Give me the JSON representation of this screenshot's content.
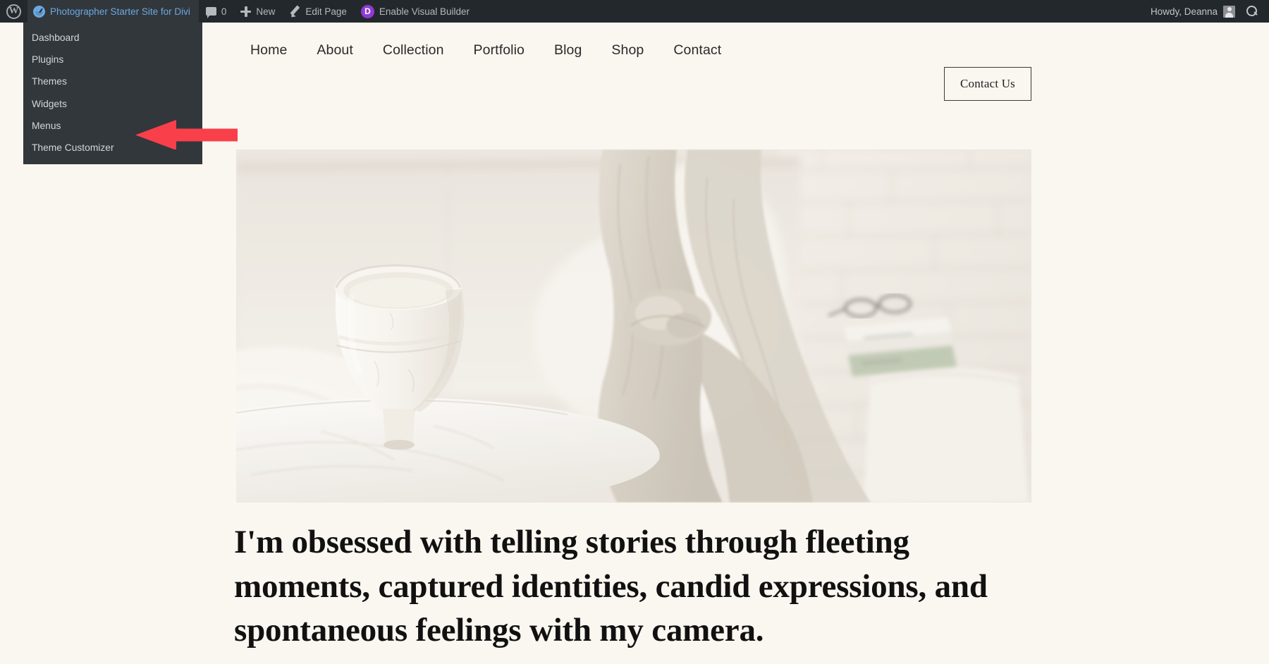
{
  "adminbar": {
    "wp_logo_glyph": "W",
    "site_name": "Photographer Starter Site for Divi",
    "comments_count": "0",
    "new_label": "New",
    "edit_page_label": "Edit Page",
    "divi_glyph": "D",
    "visual_builder_label": "Enable Visual Builder",
    "howdy": "Howdy, Deanna",
    "icons": {
      "wp_logo": "wordpress-logo-icon",
      "dashboard": "divi-dashboard-icon",
      "comments": "comment-bubble-icon",
      "new": "plus-icon",
      "edit": "pencil-icon",
      "divi": "divi-logo-icon",
      "avatar": "user-avatar-icon",
      "search": "search-icon"
    },
    "colors": {
      "bar_bg": "#23282d",
      "site_item_bg": "#32373c",
      "site_link": "#6aa9e0",
      "divi_purple": "#8f3bd4",
      "text": "#b4b9be"
    }
  },
  "admin_dropdown": {
    "items": [
      {
        "label": "Dashboard"
      },
      {
        "label": "Plugins"
      },
      {
        "label": "Themes"
      },
      {
        "label": "Widgets"
      },
      {
        "label": "Menus"
      },
      {
        "label": "Theme Customizer"
      }
    ],
    "bg": "#32373c",
    "highlighted_item": "Theme Customizer"
  },
  "annotation": {
    "arrow": {
      "name": "red-arrow-pointer",
      "color": "#f9404a",
      "direction": "left",
      "points_at": "Theme Customizer"
    }
  },
  "site": {
    "nav": [
      {
        "label": "Home"
      },
      {
        "label": "About"
      },
      {
        "label": "Collection"
      },
      {
        "label": "Portfolio"
      },
      {
        "label": "Blog"
      },
      {
        "label": "Shop"
      },
      {
        "label": "Contact"
      }
    ],
    "contact_button": "Contact Us",
    "headline": "I'm obsessed with telling stories through fleeting moments, captured identities, candid expressions, and spontaneous feelings with my camera.",
    "hero_image_alt": "White ceramic vase on a marble side table with linen throw, books and white brick wall",
    "background": "#faf6f0",
    "text_color": "#111111"
  }
}
